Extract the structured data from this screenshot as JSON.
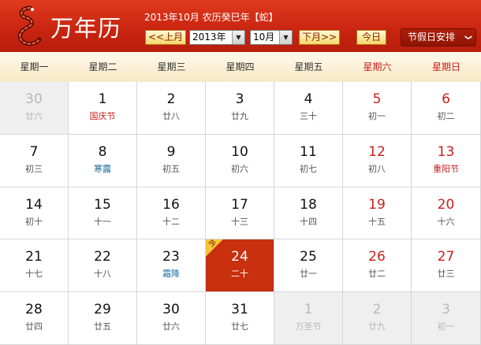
{
  "header": {
    "title": "万年历",
    "lunar_line": "2013年10月 农历癸巳年【蛇】",
    "prev_month": "<<上月",
    "year_select": "2013年",
    "month_select": "10月",
    "next_month": "下月>>",
    "today_button": "今日",
    "holiday_menu": "节假日安排",
    "holiday_chevron": "❯",
    "select_arrow": "▼"
  },
  "weekdays": [
    "星期一",
    "星期二",
    "星期三",
    "星期四",
    "星期五",
    "星期六",
    "星期日"
  ],
  "today_tag": "今",
  "colors": {
    "header_red": "#c8240f",
    "today": "#c8300e",
    "festival": "#c81e1e",
    "solar_term": "#1a6a9a",
    "western_festival": "#2a8a1a"
  },
  "weeks": [
    [
      {
        "day": "30",
        "sub": "廿六",
        "kind": "other"
      },
      {
        "day": "1",
        "sub": "国庆节",
        "subtype": "festival"
      },
      {
        "day": "2",
        "sub": "廿八"
      },
      {
        "day": "3",
        "sub": "廿九"
      },
      {
        "day": "4",
        "sub": "三十"
      },
      {
        "day": "5",
        "sub": "初一",
        "weekend": true
      },
      {
        "day": "6",
        "sub": "初二",
        "weekend": true
      }
    ],
    [
      {
        "day": "7",
        "sub": "初三"
      },
      {
        "day": "8",
        "sub": "寒露",
        "subtype": "term"
      },
      {
        "day": "9",
        "sub": "初五"
      },
      {
        "day": "10",
        "sub": "初六"
      },
      {
        "day": "11",
        "sub": "初七"
      },
      {
        "day": "12",
        "sub": "初八",
        "weekend": true
      },
      {
        "day": "13",
        "sub": "重阳节",
        "weekend": true,
        "subtype": "festival"
      }
    ],
    [
      {
        "day": "14",
        "sub": "初十"
      },
      {
        "day": "15",
        "sub": "十一"
      },
      {
        "day": "16",
        "sub": "十二"
      },
      {
        "day": "17",
        "sub": "十三"
      },
      {
        "day": "18",
        "sub": "十四"
      },
      {
        "day": "19",
        "sub": "十五",
        "weekend": true
      },
      {
        "day": "20",
        "sub": "十六",
        "weekend": true
      }
    ],
    [
      {
        "day": "21",
        "sub": "十七"
      },
      {
        "day": "22",
        "sub": "十八"
      },
      {
        "day": "23",
        "sub": "霜降",
        "subtype": "term"
      },
      {
        "day": "24",
        "sub": "二十",
        "kind": "today"
      },
      {
        "day": "25",
        "sub": "廿一"
      },
      {
        "day": "26",
        "sub": "廿二",
        "weekend": true
      },
      {
        "day": "27",
        "sub": "廿三",
        "weekend": true
      }
    ],
    [
      {
        "day": "28",
        "sub": "廿四"
      },
      {
        "day": "29",
        "sub": "廿五"
      },
      {
        "day": "30",
        "sub": "廿六"
      },
      {
        "day": "31",
        "sub": "廿七"
      },
      {
        "day": "1",
        "sub": "万圣节",
        "kind": "other",
        "subtype": "west"
      },
      {
        "day": "2",
        "sub": "廿九",
        "kind": "other"
      },
      {
        "day": "3",
        "sub": "初一",
        "kind": "other"
      }
    ]
  ]
}
